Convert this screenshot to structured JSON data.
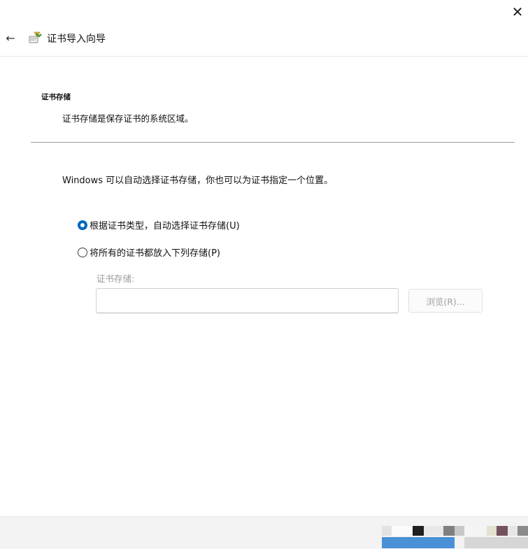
{
  "window": {
    "title": "证书导入向导",
    "close_glyph": "✕",
    "back_glyph": "←"
  },
  "header": {
    "heading": "证书存储",
    "description": "证书存储是保存证书的系统区域。"
  },
  "content": {
    "intro": "Windows 可以自动选择证书存储，你也可以为证书指定一个位置。",
    "options": [
      {
        "label": "根据证书类型，自动选择证书存储(U)",
        "checked": true
      },
      {
        "label": "将所有的证书都放入下列存储(P)",
        "checked": false
      }
    ],
    "store_label": "证书存储:",
    "store_value": "",
    "browse_label": "浏览(R)..."
  },
  "colors": {
    "accent": "#0067c0",
    "disabled_text": "#a0a0a0",
    "divider": "#a0a0a0"
  }
}
